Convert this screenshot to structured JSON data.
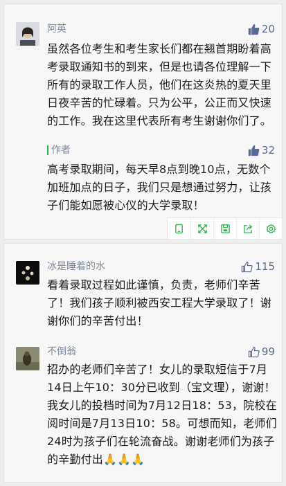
{
  "comments": [
    {
      "author": "阿英",
      "likes": "20",
      "text": "虽然各位考生和考生家长们都在翘首期盼着高考录取通知书的到来，但是也请各位理解一下所有的录取工作人员，他们在这炎热的夏天里日夜辛苦的忙碌着。只为公平，公正而又快速的工作。我在这里代表所有考生谢谢你们了。",
      "reply": {
        "label": "作者",
        "likes": "32",
        "text": "高考录取期间，每天早8点到晚10点，无数个加班加点的日子，我们只是想通过努力，让孩子们能如愿被心仪的大学录取！"
      }
    },
    {
      "author": "冰是睡着的水",
      "likes": "115",
      "text": "看着录取过程如此谨慎，负责，老师们辛苦了！我们孩子顺利被西安工程大学录取了！谢谢你们的辛苦付出！"
    },
    {
      "author": "不倒翁",
      "likes": "99",
      "text": "招办的老师们辛苦了！女儿的录取短信于7月14日上午10：30分已收到（宝文理），谢谢！我女儿的投档时间为7月12日18：53，院校在阅时间是7月13日10：58。可想而知，老师们24时为孩子们在轮流奋战。谢谢老师们为孩子的辛勤付出🙏🙏🙏"
    }
  ],
  "toolbar_icons": [
    "copy-icon",
    "expand-icon",
    "save-icon",
    "share-icon",
    "settings-icon"
  ],
  "colors": {
    "accent_name": "#7e8a9a",
    "like": "#576b95",
    "author_bar": "#2ab04a",
    "tool_icon": "#2ab04a"
  }
}
